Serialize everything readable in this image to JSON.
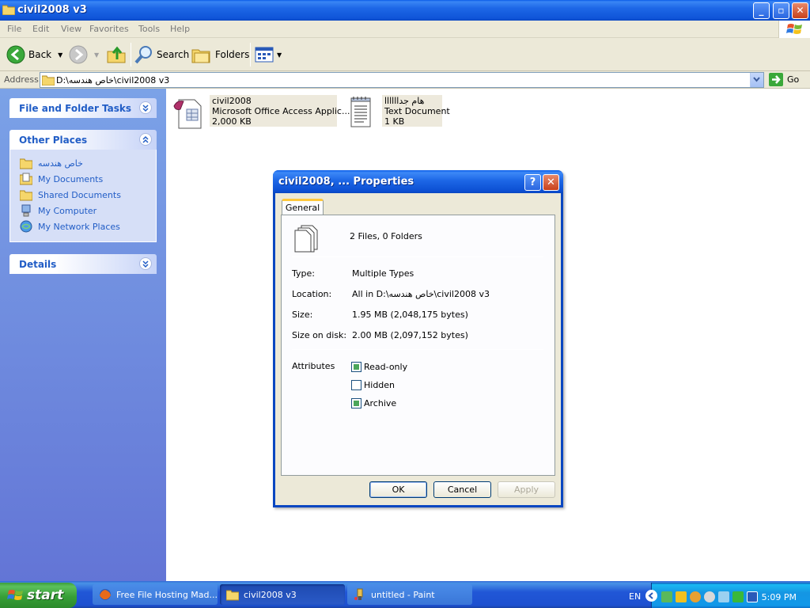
{
  "window": {
    "title": "civil2008 v3",
    "minimize": "_",
    "restore": "▫",
    "close": "✕"
  },
  "menu": [
    "File",
    "Edit",
    "View",
    "Favorites",
    "Tools",
    "Help"
  ],
  "toolbar": {
    "back_label": "Back",
    "search_label": "Search",
    "folders_label": "Folders"
  },
  "address": {
    "label": "Address",
    "path": "D:\\خاص هندسه\\civil2008 v3",
    "go_label": "Go"
  },
  "taskpane": {
    "file_tasks_title": "File and Folder Tasks",
    "other_places_title": "Other Places",
    "details_title": "Details",
    "places": [
      {
        "label": "خاص هندسه",
        "icon": "folder-icon"
      },
      {
        "label": "My Documents",
        "icon": "my-documents-icon"
      },
      {
        "label": "Shared Documents",
        "icon": "folder-icon"
      },
      {
        "label": "My Computer",
        "icon": "my-computer-icon"
      },
      {
        "label": "My Network Places",
        "icon": "network-places-icon"
      }
    ]
  },
  "files": [
    {
      "name": "civil2008",
      "type": "Microsoft Office Access Applic...",
      "size": "2,000 KB",
      "icon": "access-app-icon"
    },
    {
      "name": "هام جداااااا",
      "type": "Text Document",
      "size": "1 KB",
      "icon": "text-document-icon"
    }
  ],
  "dialog": {
    "title": "civil2008, ... Properties",
    "help": "?",
    "close": "✕",
    "tab": "General",
    "summary": "2 Files, 0 Folders",
    "props": [
      {
        "label": "Type:",
        "value": "Multiple Types"
      },
      {
        "label": "Location:",
        "value": "All in D:\\خاص هندسه\\civil2008 v3"
      },
      {
        "label": "Size:",
        "value": "1.95 MB (2,048,175 bytes)"
      },
      {
        "label": "Size on disk:",
        "value": "2.00 MB (2,097,152 bytes)"
      }
    ],
    "attributes_label": "Attributes",
    "attributes": [
      {
        "label": "Read-only",
        "state": "mixed"
      },
      {
        "label": "Hidden",
        "state": "unchecked"
      },
      {
        "label": "Archive",
        "state": "mixed"
      }
    ],
    "ok": "OK",
    "cancel": "Cancel",
    "apply": "Apply"
  },
  "taskbar": {
    "start": "start",
    "tasks": [
      {
        "label": "Free File Hosting Mad...",
        "icon": "firefox-icon"
      },
      {
        "label": "civil2008 v3",
        "icon": "folder-icon",
        "active": true
      },
      {
        "label": "untitled - Paint",
        "icon": "paint-icon"
      }
    ],
    "language": "EN",
    "clock": "5:09 PM"
  },
  "colors": {
    "xp_blue": "#0a5ce8",
    "taskpane_link": "#215dc6",
    "start_green": "#3c9e3c"
  }
}
